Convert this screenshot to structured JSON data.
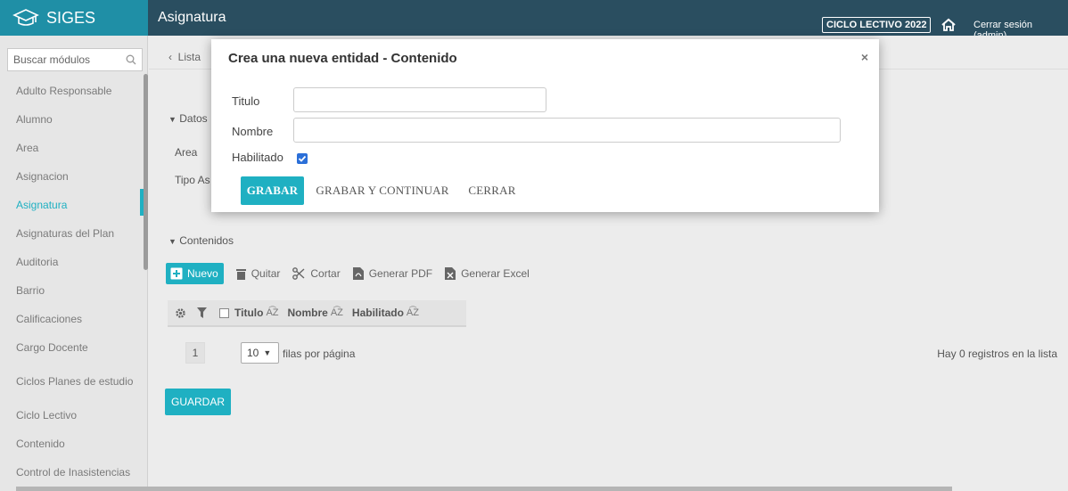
{
  "header": {
    "brand": "SIGES",
    "module_title": "Asignatura",
    "ciclo_badge": "CICLO LECTIVO 2022",
    "logout": "Cerrar sesión (admin)"
  },
  "sidebar": {
    "search_placeholder": "Buscar módulos",
    "items": [
      {
        "label": "Adulto Responsable"
      },
      {
        "label": "Alumno"
      },
      {
        "label": "Area"
      },
      {
        "label": "Asignacion"
      },
      {
        "label": "Asignatura"
      },
      {
        "label": "Asignaturas del Plan"
      },
      {
        "label": "Auditoria"
      },
      {
        "label": "Barrio"
      },
      {
        "label": "Calificaciones"
      },
      {
        "label": "Cargo Docente"
      },
      {
        "label": "Ciclos Planes de estudio"
      },
      {
        "label": "Ciclo Lectivo"
      },
      {
        "label": "Contenido"
      },
      {
        "label": "Control de Inasistencias"
      }
    ],
    "active_index": 4
  },
  "main": {
    "breadcrumb": "Lista",
    "datos_section": "Datos",
    "field_area": "Area",
    "field_tipo": "Tipo As",
    "contenidos_section": "Contenidos",
    "toolbar": {
      "nuevo": "Nuevo",
      "quitar": "Quitar",
      "cortar": "Cortar",
      "pdf": "Generar PDF",
      "excel": "Generar Excel"
    },
    "grid_columns": [
      "Titulo",
      "Nombre",
      "Habilitado"
    ],
    "page_number": "1",
    "rows_per_page": "10",
    "rows_label": "filas por página",
    "no_records": "Hay 0 registros en la lista",
    "guardar": "GUARDAR"
  },
  "modal": {
    "title": "Crea una nueva entidad - Contenido",
    "close": "×",
    "titulo_label": "Titulo",
    "titulo_value": "",
    "nombre_label": "Nombre",
    "nombre_value": "",
    "habilitado_label": "Habilitado",
    "habilitado_checked": true,
    "btn_grabar": "GRABAR",
    "btn_grabar_continuar": "GRABAR Y CONTINUAR",
    "btn_cerrar": "CERRAR"
  },
  "colors": {
    "accent": "#1fb0c2",
    "topbar": "#2a4e60",
    "brand_bg": "#1f8fa6"
  }
}
